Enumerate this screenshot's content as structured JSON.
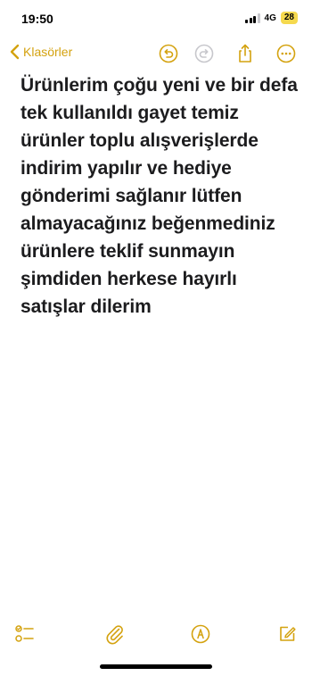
{
  "status_bar": {
    "time": "19:50",
    "network": "4G",
    "battery": "28"
  },
  "nav": {
    "back_label": "Klasörler",
    "accent_color": "#d4a20f",
    "icons": [
      "undo-icon",
      "redo-icon",
      "share-icon",
      "more-icon"
    ]
  },
  "note": {
    "text": "Ürünlerim çoğu yeni ve bir defa tek kullanıldı gayet temiz ürünler toplu alışverişlerde indirim yapılır ve hediye gönderimi sağlanır lütfen almayacağınız beğenmediniz ürünlere teklif sunmayın şimdiden herkese hayırlı satışlar dilerim"
  },
  "toolbar": {
    "icons": [
      "checklist-icon",
      "paperclip-icon",
      "markup-pen-icon",
      "compose-icon"
    ]
  }
}
